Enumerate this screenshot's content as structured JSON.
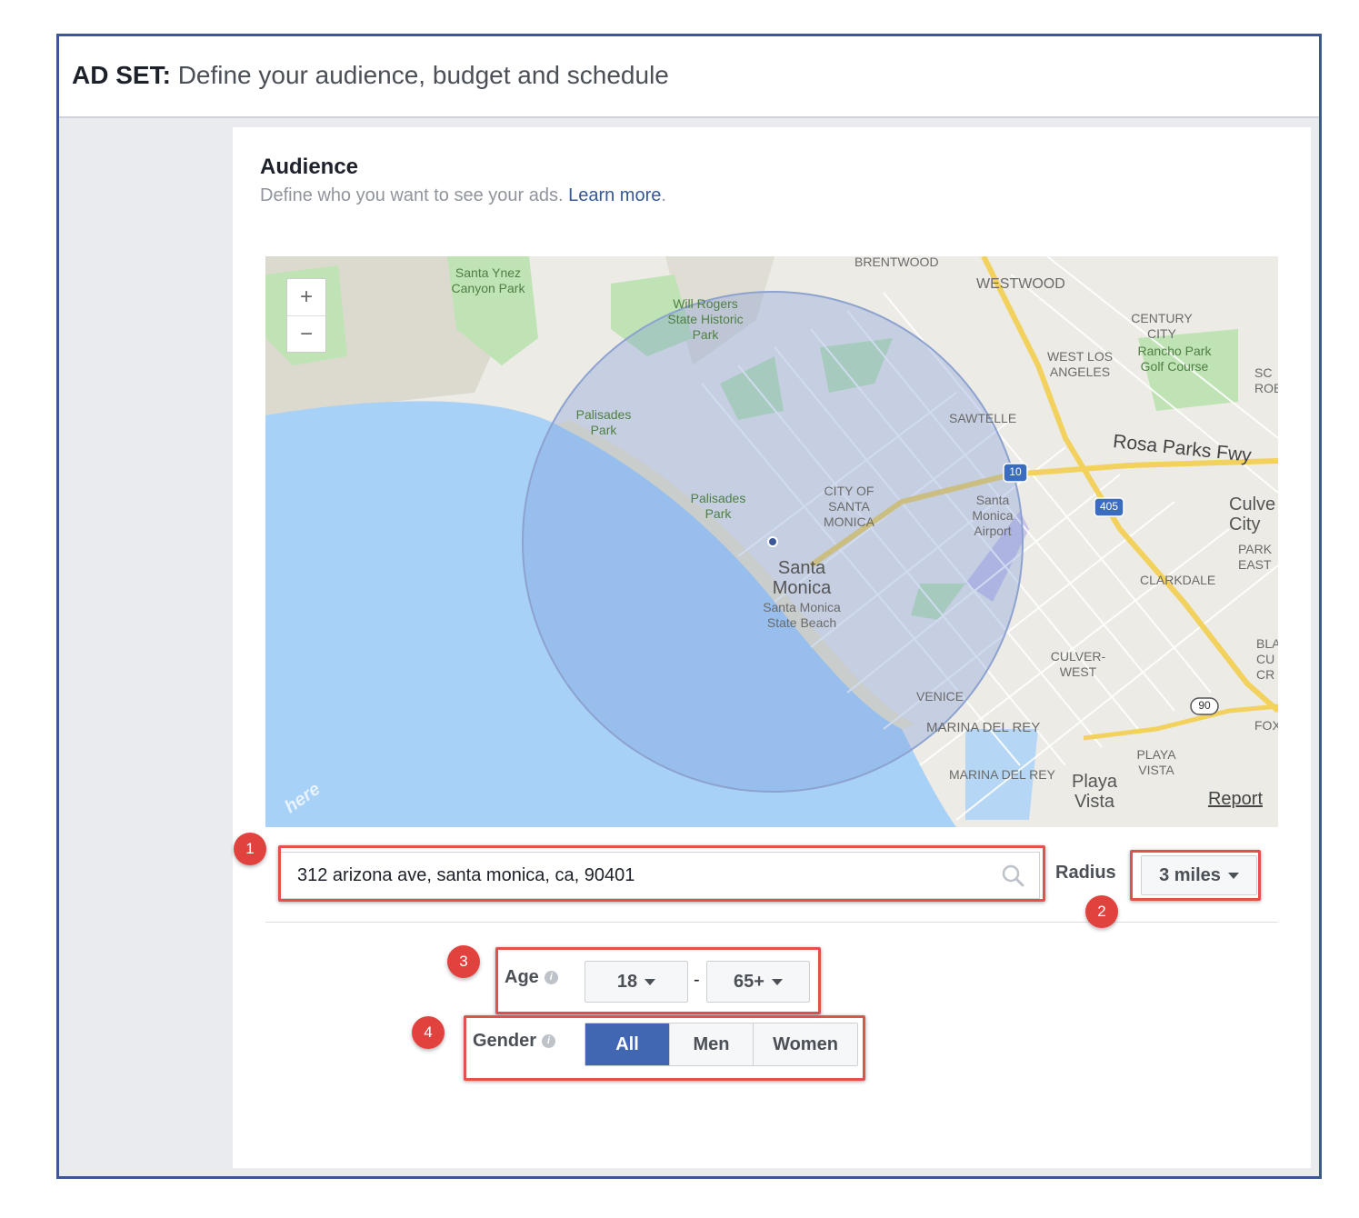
{
  "header": {
    "prefix": "AD SET:",
    "title": "Define your audience, budget and schedule"
  },
  "audience": {
    "title": "Audience",
    "subtitle": "Define who you want to see your ads.",
    "link": "Learn more",
    "period": "."
  },
  "map": {
    "zoom_in": "+",
    "zoom_out": "−",
    "report": "Report",
    "provider": "here",
    "labels": {
      "brentwood": "BRENTWOOD",
      "westwood": "WESTWOOD",
      "santa_ynez_1": "Santa Ynez",
      "santa_ynez_2": "Canyon Park",
      "will_rogers_1": "Will Rogers",
      "will_rogers_2": "State Historic",
      "will_rogers_3": "Park",
      "century_1": "CENTURY",
      "century_2": "CITY",
      "rancho_1": "Rancho Park",
      "rancho_2": "Golf Course",
      "wla_1": "WEST LOS",
      "wla_2": "ANGELES",
      "sc_1": "SC",
      "sc_2": "ROB",
      "palisades1_1": "Palisades",
      "palisades1_2": "Park",
      "sawtelle": "SAWTELLE",
      "rosa_parks": "Rosa Parks Fwy",
      "hwy10": "10",
      "hwy405": "405",
      "hwy90": "90",
      "palisades2_1": "Palisades",
      "palisades2_2": "Park",
      "cityof_1": "CITY OF",
      "cityof_2": "SANTA",
      "cityof_3": "MONICA",
      "airport_1": "Santa",
      "airport_2": "Monica",
      "airport_3": "Airport",
      "culver_city_1": "Culve",
      "culver_city_2": "City",
      "park_east_1": "PARK",
      "park_east_2": "EAST",
      "santa_monica_1": "Santa",
      "santa_monica_2": "Monica",
      "beach_1": "Santa Monica",
      "beach_2": "State Beach",
      "clarkdale": "CLARKDALE",
      "culver_west_1": "CULVER-",
      "culver_west_2": "WEST",
      "bla_1": "BLA",
      "bla_2": "CU",
      "bla_3": "CR",
      "venice": "VENICE",
      "marina1": "MARINA DEL REY",
      "fox": "FOX",
      "playa_vista_1": "PLAYA",
      "playa_vista_2": "VISTA",
      "marina2": "MARINA DEL REY",
      "playa_1": "Playa",
      "playa_2": "Vista"
    }
  },
  "location": {
    "search_value": "312 arizona ave, santa monica, ca, 90401"
  },
  "radius": {
    "label": "Radius",
    "value": "3 miles"
  },
  "age": {
    "label": "Age",
    "min": "18",
    "max": "65+",
    "separator": "-"
  },
  "gender": {
    "label": "Gender",
    "options": [
      "All",
      "Men",
      "Women"
    ],
    "selected": "All"
  },
  "annotations": [
    "1",
    "2",
    "3",
    "4"
  ],
  "colors": {
    "accent": "#4267b2",
    "highlight": "#e2514c",
    "frame": "#3b5894",
    "water": "#a7d1f7"
  }
}
